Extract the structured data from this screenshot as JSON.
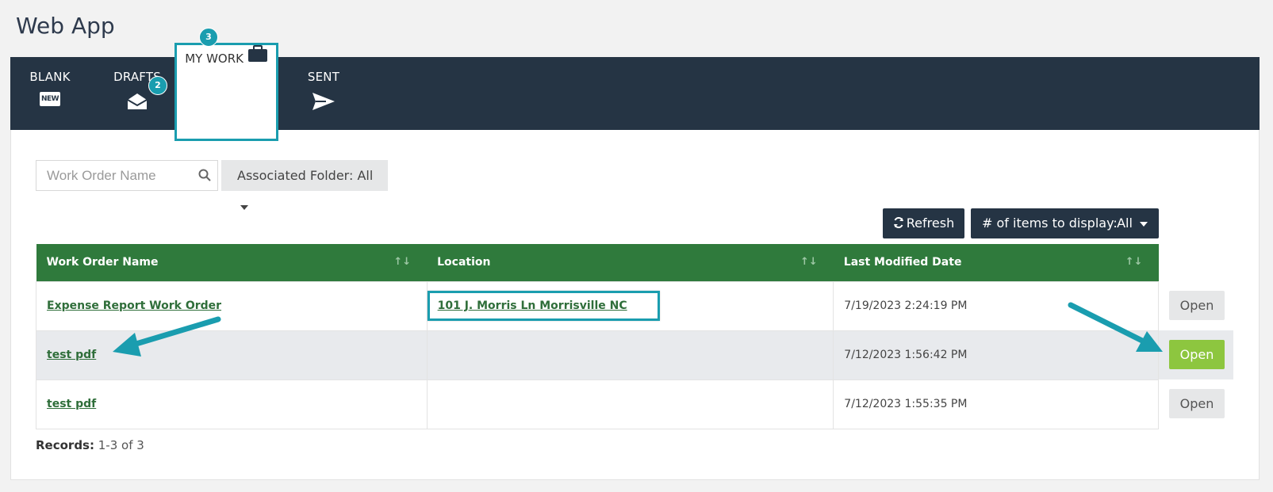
{
  "app": {
    "title": "Web App"
  },
  "tabs": [
    {
      "label": "BLANK",
      "icon": "new-icon",
      "icon_text": "NEW"
    },
    {
      "label": "DRAFTS",
      "icon": "envelope-open-icon",
      "badge": "2"
    },
    {
      "label": "MY WORK",
      "icon": "briefcase-icon",
      "badge": "3",
      "active": true
    },
    {
      "label": "SENT",
      "icon": "paper-plane-icon"
    }
  ],
  "filters": {
    "search_placeholder": "Work Order Name",
    "folder_label": "Associated Folder: All"
  },
  "toolbar": {
    "refresh_label": "Refresh",
    "items_label": "# of items to display:",
    "items_value": "All"
  },
  "table": {
    "headers": [
      "Work Order Name",
      "Location",
      "Last Modified Date"
    ],
    "rows": [
      {
        "name": "Expense Report Work Order",
        "location": "101 J. Morris Ln Morrisville NC",
        "modified": "7/19/2023 2:24:19 PM",
        "action": "Open"
      },
      {
        "name": "test pdf",
        "location": "",
        "modified": "7/12/2023 1:56:42 PM",
        "action": "Open"
      },
      {
        "name": "test pdf",
        "location": "",
        "modified": "7/12/2023 1:55:35 PM",
        "action": "Open"
      }
    ]
  },
  "footer": {
    "records_label": "Records:",
    "records_value": "1-3 of 3"
  },
  "colors": {
    "navbar": "#253444",
    "accent": "#1a9daf",
    "header_green": "#2f7a3c",
    "open_primary": "#8dc63f"
  }
}
